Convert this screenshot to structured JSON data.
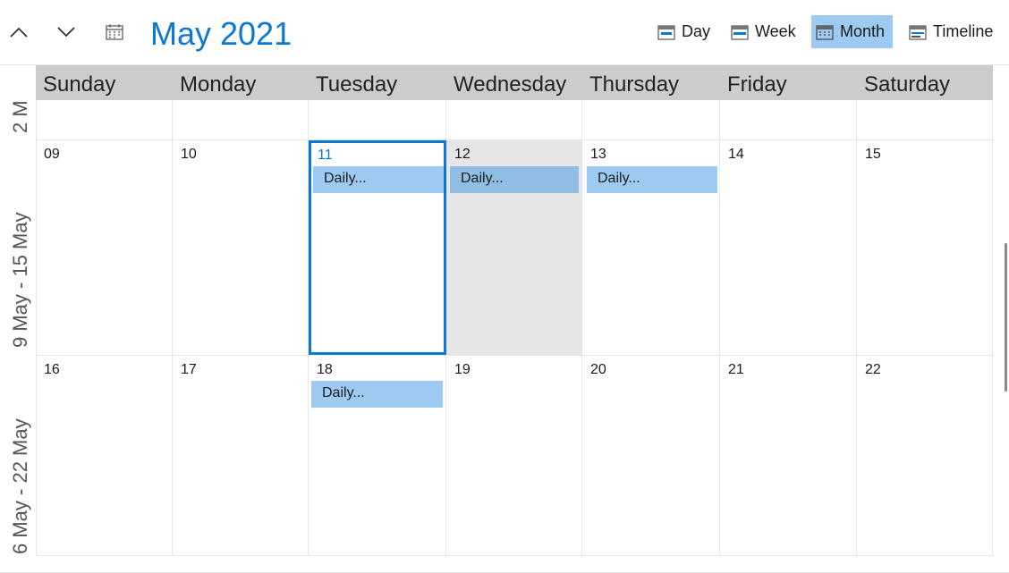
{
  "toolbar": {
    "title": "May 2021",
    "views": [
      {
        "label": "Day"
      },
      {
        "label": "Week"
      },
      {
        "label": "Month"
      },
      {
        "label": "Timeline"
      }
    ],
    "active_view": "Month"
  },
  "days_of_week": [
    "Sunday",
    "Monday",
    "Tuesday",
    "Wednesday",
    "Thursday",
    "Friday",
    "Saturday"
  ],
  "weeks": [
    {
      "label": "2 M",
      "days": [
        "",
        "",
        "",
        "",
        "",
        "",
        ""
      ]
    },
    {
      "label": "9 May - 15 May",
      "days": [
        "09",
        "10",
        "11",
        "12",
        "13",
        "14",
        "15"
      ]
    },
    {
      "label": "6 May - 22 May",
      "days": [
        "16",
        "17",
        "18",
        "19",
        "20",
        "21",
        "22"
      ]
    }
  ],
  "appointments": [
    {
      "subject": "Daily..."
    },
    {
      "subject": "Daily..."
    },
    {
      "subject": "Daily..."
    },
    {
      "subject": "Daily..."
    }
  ],
  "colors": {
    "accent": "#0a78d4",
    "appointment": "#9ccaf0",
    "header": "#cccccc",
    "hover": "#e6e6e6"
  }
}
